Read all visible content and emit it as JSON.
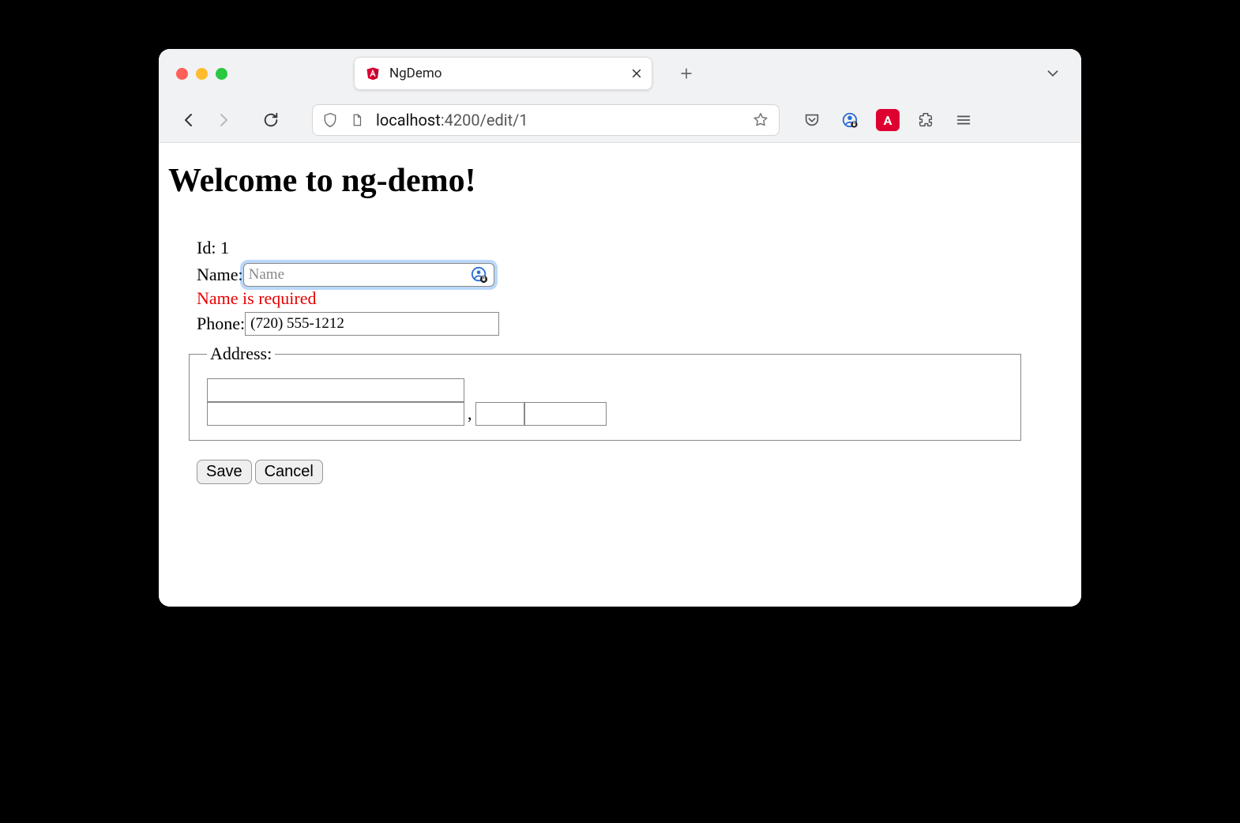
{
  "browser": {
    "tab_title": "NgDemo",
    "url_host": "localhost",
    "url_path": ":4200/edit/1"
  },
  "page": {
    "heading": "Welcome to ng-demo!",
    "id_label": "Id:",
    "id_value": "1",
    "name_label": "Name:",
    "name_placeholder": "Name",
    "name_value": "",
    "name_error": "Name is required",
    "phone_label": "Phone:",
    "phone_value": "(720) 555-1212",
    "address_legend": "Address:",
    "street_value": "",
    "city_value": "",
    "state_value": "",
    "zip_value": "",
    "comma": ",",
    "save_label": "Save",
    "cancel_label": "Cancel"
  }
}
